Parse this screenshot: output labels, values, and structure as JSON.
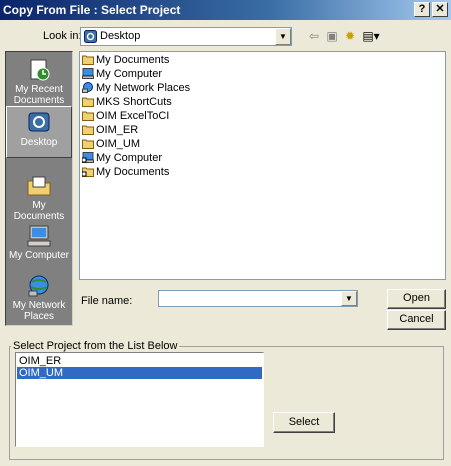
{
  "window": {
    "title": "Copy From File : Select Project",
    "help_label": "?",
    "close_label": "✕"
  },
  "lookin": {
    "label": "Look in:",
    "value": "Desktop"
  },
  "toolbar": {
    "back_icon": "⇦",
    "up_icon": "▣",
    "new_folder_icon": "✹",
    "view_icon": "▤▾"
  },
  "places": [
    {
      "label": "My Recent Documents",
      "icon": "recent-documents-icon"
    },
    {
      "label": "Desktop",
      "icon": "desktop-icon"
    },
    {
      "label": "My Documents",
      "icon": "my-documents-icon"
    },
    {
      "label": "My Computer",
      "icon": "my-computer-icon"
    },
    {
      "label": "My Network Places",
      "icon": "network-places-icon"
    }
  ],
  "files": [
    {
      "name": "My Documents",
      "icon": "documents-folder-icon"
    },
    {
      "name": "My Computer",
      "icon": "computer-icon"
    },
    {
      "name": "My Network Places",
      "icon": "network-icon"
    },
    {
      "name": "MKS ShortCuts",
      "icon": "folder-icon"
    },
    {
      "name": "OIM ExcelToCI",
      "icon": "folder-icon"
    },
    {
      "name": "OIM_ER",
      "icon": "folder-icon"
    },
    {
      "name": "OIM_UM",
      "icon": "folder-icon"
    },
    {
      "name": "My Computer",
      "icon": "computer-shortcut-icon"
    },
    {
      "name": "My Documents",
      "icon": "documents-shortcut-icon"
    }
  ],
  "filename": {
    "label": "File name:",
    "value": ""
  },
  "buttons": {
    "open": "Open",
    "cancel": "Cancel",
    "select": "Select"
  },
  "project_group": {
    "label": "Select Project from the List Below",
    "items": [
      "OIM_ER",
      "OIM_UM"
    ],
    "selected": "OIM_UM"
  }
}
